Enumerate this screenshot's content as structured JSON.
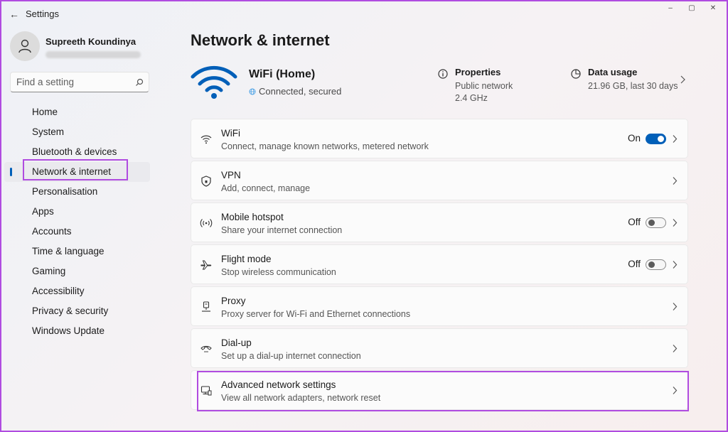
{
  "window": {
    "title": "Settings",
    "back_label": "←",
    "min": "–",
    "max": "▢",
    "close": "✕"
  },
  "profile": {
    "name": "Supreeth Koundinya"
  },
  "search": {
    "placeholder": "Find a setting"
  },
  "nav": {
    "items": [
      {
        "label": "Home"
      },
      {
        "label": "System"
      },
      {
        "label": "Bluetooth & devices"
      },
      {
        "label": "Network & internet",
        "selected": true
      },
      {
        "label": "Personalisation"
      },
      {
        "label": "Apps"
      },
      {
        "label": "Accounts"
      },
      {
        "label": "Time & language"
      },
      {
        "label": "Gaming"
      },
      {
        "label": "Accessibility"
      },
      {
        "label": "Privacy & security"
      },
      {
        "label": "Windows Update"
      }
    ]
  },
  "main": {
    "title": "Network & internet",
    "hero": {
      "name": "WiFi (Home)",
      "status": "Connected, secured",
      "properties": {
        "title": "Properties",
        "line1": "Public network",
        "line2": "2.4 GHz"
      },
      "usage": {
        "title": "Data usage",
        "line": "21.96 GB, last 30 days"
      }
    },
    "cards": [
      {
        "title": "WiFi",
        "sub": "Connect, manage known networks, metered network",
        "icon": "wifi-icon",
        "toggle": "On"
      },
      {
        "title": "VPN",
        "sub": "Add, connect, manage",
        "icon": "shield-icon"
      },
      {
        "title": "Mobile hotspot",
        "sub": "Share your internet connection",
        "icon": "hotspot-icon",
        "toggle": "Off"
      },
      {
        "title": "Flight mode",
        "sub": "Stop wireless communication",
        "icon": "airplane-icon",
        "toggle": "Off"
      },
      {
        "title": "Proxy",
        "sub": "Proxy server for Wi-Fi and Ethernet connections",
        "icon": "proxy-icon"
      },
      {
        "title": "Dial-up",
        "sub": "Set up a dial-up internet connection",
        "icon": "dialup-icon"
      },
      {
        "title": "Advanced network settings",
        "sub": "View all network adapters, network reset",
        "icon": "network-adapter-icon"
      }
    ]
  },
  "colors": {
    "accent": "#005fb8",
    "highlight": "#b04ce0"
  }
}
